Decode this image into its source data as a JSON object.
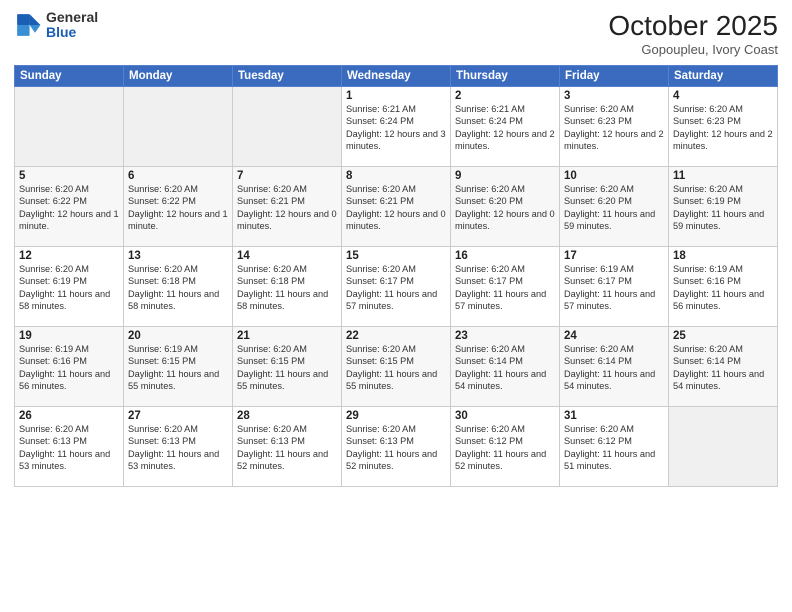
{
  "header": {
    "logo": {
      "line1": "General",
      "line2": "Blue"
    },
    "title": "October 2025",
    "location": "Gopoupleu, Ivory Coast"
  },
  "weekdays": [
    "Sunday",
    "Monday",
    "Tuesday",
    "Wednesday",
    "Thursday",
    "Friday",
    "Saturday"
  ],
  "weeks": [
    [
      {
        "day": "",
        "info": ""
      },
      {
        "day": "",
        "info": ""
      },
      {
        "day": "",
        "info": ""
      },
      {
        "day": "1",
        "info": "Sunrise: 6:21 AM\nSunset: 6:24 PM\nDaylight: 12 hours\nand 3 minutes."
      },
      {
        "day": "2",
        "info": "Sunrise: 6:21 AM\nSunset: 6:24 PM\nDaylight: 12 hours\nand 2 minutes."
      },
      {
        "day": "3",
        "info": "Sunrise: 6:20 AM\nSunset: 6:23 PM\nDaylight: 12 hours\nand 2 minutes."
      },
      {
        "day": "4",
        "info": "Sunrise: 6:20 AM\nSunset: 6:23 PM\nDaylight: 12 hours\nand 2 minutes."
      }
    ],
    [
      {
        "day": "5",
        "info": "Sunrise: 6:20 AM\nSunset: 6:22 PM\nDaylight: 12 hours\nand 1 minute."
      },
      {
        "day": "6",
        "info": "Sunrise: 6:20 AM\nSunset: 6:22 PM\nDaylight: 12 hours\nand 1 minute."
      },
      {
        "day": "7",
        "info": "Sunrise: 6:20 AM\nSunset: 6:21 PM\nDaylight: 12 hours\nand 0 minutes."
      },
      {
        "day": "8",
        "info": "Sunrise: 6:20 AM\nSunset: 6:21 PM\nDaylight: 12 hours\nand 0 minutes."
      },
      {
        "day": "9",
        "info": "Sunrise: 6:20 AM\nSunset: 6:20 PM\nDaylight: 12 hours\nand 0 minutes."
      },
      {
        "day": "10",
        "info": "Sunrise: 6:20 AM\nSunset: 6:20 PM\nDaylight: 11 hours\nand 59 minutes."
      },
      {
        "day": "11",
        "info": "Sunrise: 6:20 AM\nSunset: 6:19 PM\nDaylight: 11 hours\nand 59 minutes."
      }
    ],
    [
      {
        "day": "12",
        "info": "Sunrise: 6:20 AM\nSunset: 6:19 PM\nDaylight: 11 hours\nand 58 minutes."
      },
      {
        "day": "13",
        "info": "Sunrise: 6:20 AM\nSunset: 6:18 PM\nDaylight: 11 hours\nand 58 minutes."
      },
      {
        "day": "14",
        "info": "Sunrise: 6:20 AM\nSunset: 6:18 PM\nDaylight: 11 hours\nand 58 minutes."
      },
      {
        "day": "15",
        "info": "Sunrise: 6:20 AM\nSunset: 6:17 PM\nDaylight: 11 hours\nand 57 minutes."
      },
      {
        "day": "16",
        "info": "Sunrise: 6:20 AM\nSunset: 6:17 PM\nDaylight: 11 hours\nand 57 minutes."
      },
      {
        "day": "17",
        "info": "Sunrise: 6:19 AM\nSunset: 6:17 PM\nDaylight: 11 hours\nand 57 minutes."
      },
      {
        "day": "18",
        "info": "Sunrise: 6:19 AM\nSunset: 6:16 PM\nDaylight: 11 hours\nand 56 minutes."
      }
    ],
    [
      {
        "day": "19",
        "info": "Sunrise: 6:19 AM\nSunset: 6:16 PM\nDaylight: 11 hours\nand 56 minutes."
      },
      {
        "day": "20",
        "info": "Sunrise: 6:19 AM\nSunset: 6:15 PM\nDaylight: 11 hours\nand 55 minutes."
      },
      {
        "day": "21",
        "info": "Sunrise: 6:20 AM\nSunset: 6:15 PM\nDaylight: 11 hours\nand 55 minutes."
      },
      {
        "day": "22",
        "info": "Sunrise: 6:20 AM\nSunset: 6:15 PM\nDaylight: 11 hours\nand 55 minutes."
      },
      {
        "day": "23",
        "info": "Sunrise: 6:20 AM\nSunset: 6:14 PM\nDaylight: 11 hours\nand 54 minutes."
      },
      {
        "day": "24",
        "info": "Sunrise: 6:20 AM\nSunset: 6:14 PM\nDaylight: 11 hours\nand 54 minutes."
      },
      {
        "day": "25",
        "info": "Sunrise: 6:20 AM\nSunset: 6:14 PM\nDaylight: 11 hours\nand 54 minutes."
      }
    ],
    [
      {
        "day": "26",
        "info": "Sunrise: 6:20 AM\nSunset: 6:13 PM\nDaylight: 11 hours\nand 53 minutes."
      },
      {
        "day": "27",
        "info": "Sunrise: 6:20 AM\nSunset: 6:13 PM\nDaylight: 11 hours\nand 53 minutes."
      },
      {
        "day": "28",
        "info": "Sunrise: 6:20 AM\nSunset: 6:13 PM\nDaylight: 11 hours\nand 52 minutes."
      },
      {
        "day": "29",
        "info": "Sunrise: 6:20 AM\nSunset: 6:13 PM\nDaylight: 11 hours\nand 52 minutes."
      },
      {
        "day": "30",
        "info": "Sunrise: 6:20 AM\nSunset: 6:12 PM\nDaylight: 11 hours\nand 52 minutes."
      },
      {
        "day": "31",
        "info": "Sunrise: 6:20 AM\nSunset: 6:12 PM\nDaylight: 11 hours\nand 51 minutes."
      },
      {
        "day": "",
        "info": ""
      }
    ]
  ]
}
